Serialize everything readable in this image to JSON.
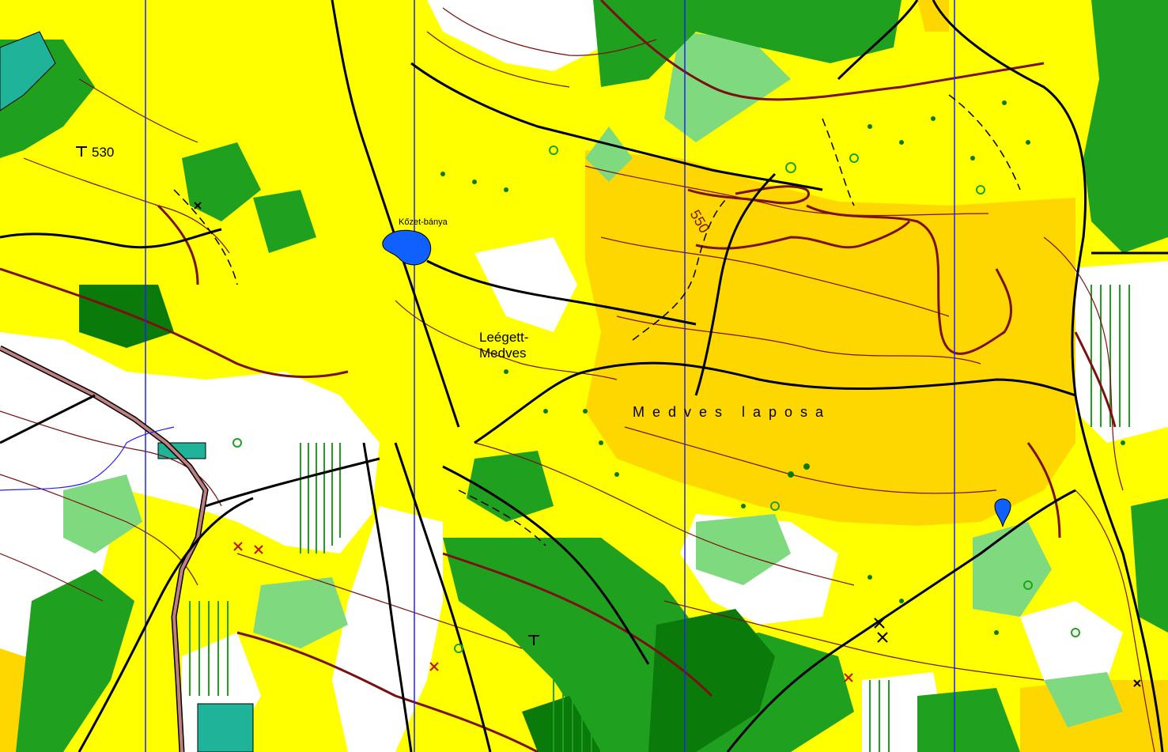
{
  "map": {
    "labels": {
      "spot_height": "530",
      "pond": "Kőzet-bánya",
      "place_line1": "Leégett-",
      "place_line2": "Medves",
      "plateau": "Medves laposa",
      "contour_value": "550"
    },
    "colors": {
      "open_land": "#ffd700",
      "rough_open": "#ffff00",
      "forest_slow": "#7fd97f",
      "forest_dense": "#1fa01f",
      "forest_very_dense": "#0a7a0a",
      "contour": "#7a1010",
      "magnetic_north": "#2020ff",
      "water": "#1060ff",
      "road_paved": "#c08080",
      "settlement": "#1fb39a",
      "path": "#000000"
    }
  }
}
